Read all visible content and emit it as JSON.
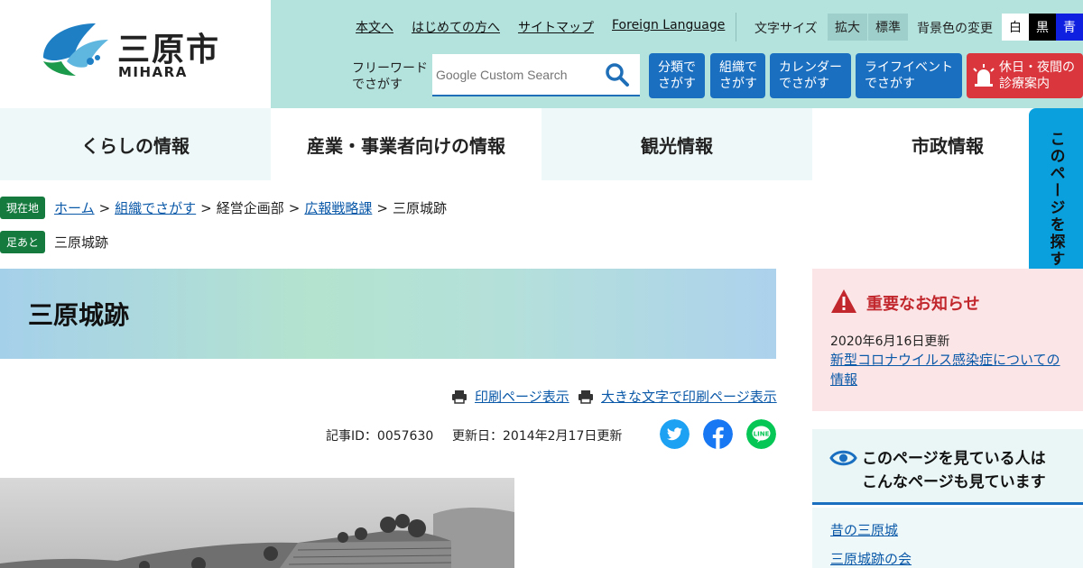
{
  "header": {
    "logo_jp": "三原市",
    "logo_en": "MIHARA",
    "top_links": [
      "本文へ",
      "はじめての方へ",
      "サイトマップ",
      "Foreign Language"
    ],
    "font_size_label": "文字サイズ",
    "font_size_buttons": [
      "拡大",
      "標準"
    ],
    "bg_label": "背景色の変更",
    "bg_buttons": [
      "白",
      "黒",
      "青"
    ],
    "freeword_label_1": "フリーワード",
    "freeword_label_2": "でさがす",
    "search_placeholder": "Google Custom Search",
    "nav_buttons": [
      {
        "l1": "分類で",
        "l2": "さがす"
      },
      {
        "l1": "組織で",
        "l2": "さがす"
      },
      {
        "l1": "カレンダー",
        "l2": "でさがす"
      },
      {
        "l1": "ライフイベント",
        "l2": "でさがす"
      }
    ],
    "emergency": {
      "l1": "休日・夜間の",
      "l2": "診療案内"
    }
  },
  "global_nav": [
    "くらしの情報",
    "産業・事業者向けの情報",
    "観光情報",
    "市政情報"
  ],
  "side_tab": "このページを探する",
  "breadcrumb": {
    "tag": "現在地",
    "items": [
      "ホーム",
      "組織でさがす",
      "経営企画部",
      "広報戦略課",
      "三原城跡"
    ]
  },
  "footprint": {
    "tag": "足あと",
    "item": "三原城跡"
  },
  "page_title": "三原城跡",
  "print_links": [
    "印刷ページ表示",
    "大きな文字で印刷ページ表示"
  ],
  "meta": {
    "article_id": "記事ID：0057630",
    "updated": "更新日：2014年2月17日更新"
  },
  "colors": {
    "accent": "#1a6fc0",
    "header_bg": "#b4e3de",
    "alert": "#c1272d",
    "green": "#157a3e"
  },
  "notice": {
    "title": "重要なお知らせ",
    "date": "2020年6月16日更新",
    "link": "新型コロナウイルス感染症についての情報"
  },
  "related": {
    "title_l1": "このページを見ている人は",
    "title_l2": "こんなページも見ています",
    "items": [
      "昔の三原城",
      "三原城跡の会"
    ]
  }
}
